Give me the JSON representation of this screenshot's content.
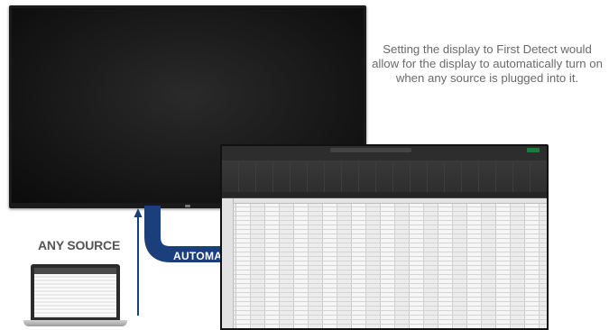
{
  "caption": {
    "text": "Setting the display to First Detect would allow for the display to automatically turn on when any source is plugged into it."
  },
  "labels": {
    "any_source": "ANY SOURCE",
    "automatic": "AUTOMATIC"
  },
  "colors": {
    "arrow_blue": "#1a3f7a",
    "caption_gray": "#6a6a6a",
    "source_label_gray": "#555555",
    "display_body": "#1a1a1a"
  },
  "icons": {
    "display": "flat-panel-display",
    "laptop": "laptop-computer",
    "spreadsheet": "spreadsheet-monitor",
    "arrow": "right-arrow"
  }
}
